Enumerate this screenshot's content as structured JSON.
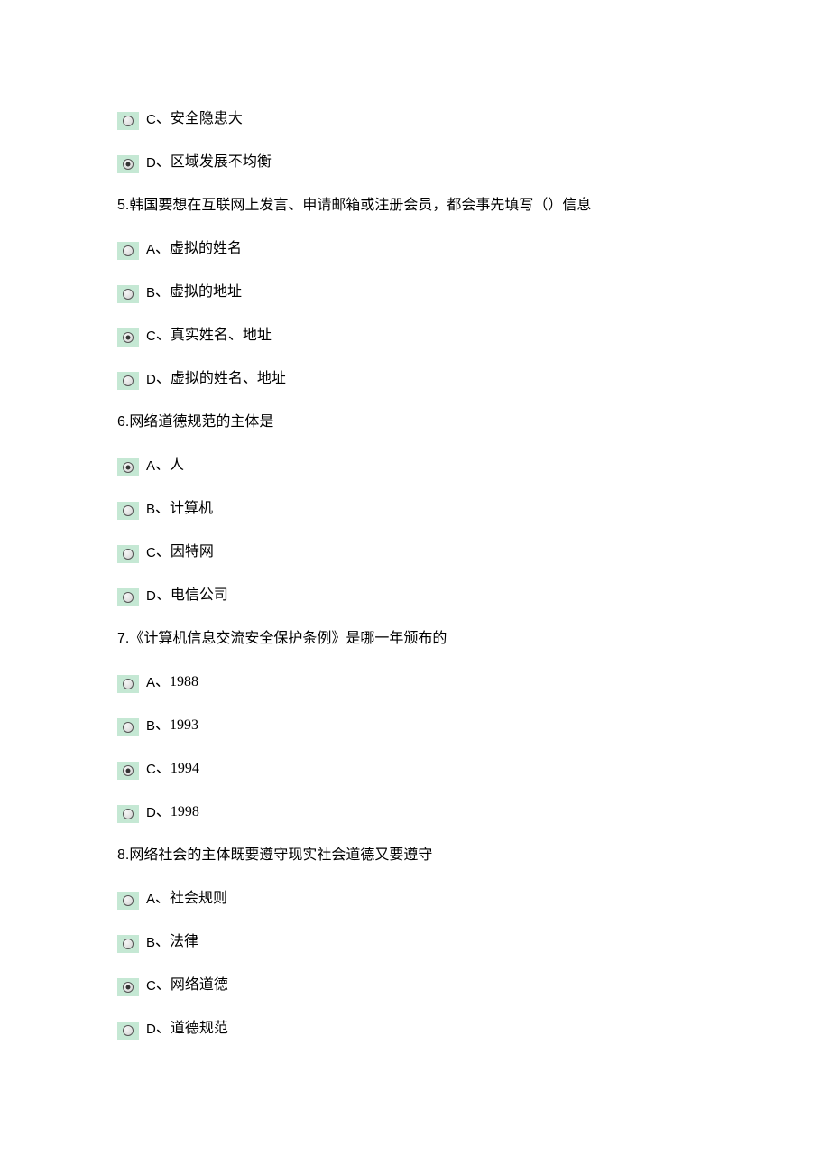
{
  "earlyOptions": [
    {
      "letter": "C",
      "text": "、安全隐患大",
      "selected": false
    },
    {
      "letter": "D",
      "text": "、区域发展不均衡",
      "selected": true
    }
  ],
  "questions": [
    {
      "number": "5.",
      "text": "韩国要想在互联网上发言、申请邮箱或注册会员，都会事先填写（）信息",
      "options": [
        {
          "letter": "A",
          "text": "、虚拟的姓名",
          "selected": false
        },
        {
          "letter": "B",
          "text": "、虚拟的地址",
          "selected": false
        },
        {
          "letter": "C",
          "text": "、真实姓名、地址",
          "selected": true
        },
        {
          "letter": "D",
          "text": "、虚拟的姓名、地址",
          "selected": false
        }
      ]
    },
    {
      "number": "6.",
      "text": "网络道德规范的主体是",
      "options": [
        {
          "letter": "A",
          "text": "、人",
          "selected": true
        },
        {
          "letter": "B",
          "text": "、计算机",
          "selected": false
        },
        {
          "letter": "C",
          "text": "、因特网",
          "selected": false
        },
        {
          "letter": "D",
          "text": "、电信公司",
          "selected": false
        }
      ]
    },
    {
      "number": "7.",
      "text": "《计算机信息交流安全保护条例》是哪一年颁布的",
      "options": [
        {
          "letter": "A",
          "text": "、1988",
          "selected": false
        },
        {
          "letter": "B",
          "text": "、1993",
          "selected": false
        },
        {
          "letter": "C",
          "text": "、1994",
          "selected": true
        },
        {
          "letter": "D",
          "text": "、1998",
          "selected": false
        }
      ]
    },
    {
      "number": "8.",
      "text": "网络社会的主体既要遵守现实社会道德又要遵守",
      "options": [
        {
          "letter": "A",
          "text": "、社会规则",
          "selected": false
        },
        {
          "letter": "B",
          "text": "、法律",
          "selected": false
        },
        {
          "letter": "C",
          "text": "、网络道德",
          "selected": true
        },
        {
          "letter": "D",
          "text": "、道德规范",
          "selected": false
        }
      ]
    }
  ]
}
